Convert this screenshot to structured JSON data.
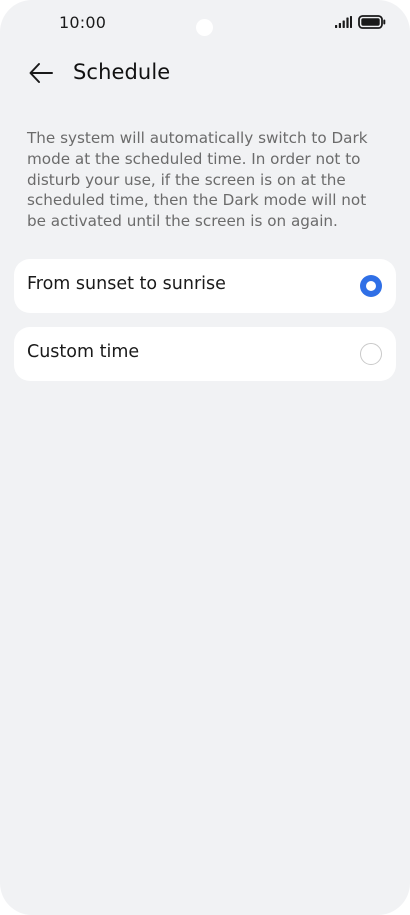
{
  "status_bar": {
    "time": "10:00",
    "icons": [
      "signal-icon",
      "battery-icon"
    ]
  },
  "header": {
    "back_icon": "arrow-left-icon",
    "title": "Schedule"
  },
  "description": "The system will automatically switch to Dark mode at the scheduled time. In order not to disturb your use, if the screen is on at the scheduled time, then the Dark mode will not be activated until the screen is on again.",
  "options": [
    {
      "label": "From sunset to sunrise",
      "selected": true
    },
    {
      "label": "Custom time",
      "selected": false
    }
  ],
  "colors": {
    "accent": "#2f6fe6",
    "background": "#f1f2f4",
    "card": "#ffffff",
    "description_text": "#6b6b6b"
  }
}
